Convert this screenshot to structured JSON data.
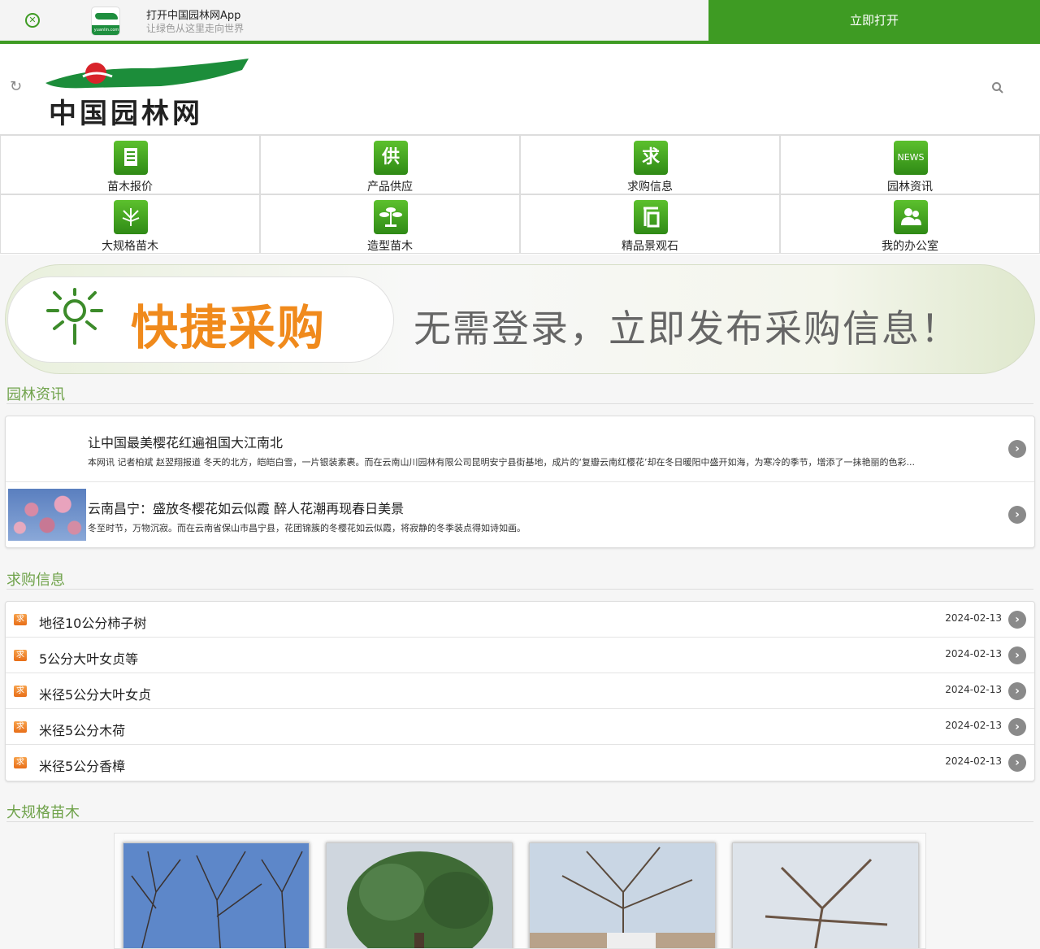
{
  "appbar": {
    "title": "打开中国园林网App",
    "subtitle": "让绿色从这里走向世界",
    "open_label": "立即打开",
    "logo_text": "yuanlin.com"
  },
  "header": {
    "logo_text": "中国园林网"
  },
  "nav": {
    "items": [
      {
        "label": "苗木报价",
        "icon": "document-icon"
      },
      {
        "label": "产品供应",
        "icon": "supply-icon"
      },
      {
        "label": "求购信息",
        "icon": "purchase-icon"
      },
      {
        "label": "园林资讯",
        "icon": "news-icon"
      },
      {
        "label": "大规格苗木",
        "icon": "tree-icon"
      },
      {
        "label": "造型苗木",
        "icon": "bonsai-icon"
      },
      {
        "label": "精品景观石",
        "icon": "stone-icon"
      },
      {
        "label": "我的办公室",
        "icon": "users-icon"
      }
    ],
    "glyphs": {
      "supply": "供",
      "purchase": "求",
      "news": "NEWS"
    }
  },
  "banner": {
    "quick": "快捷采购",
    "slogan": "无需登录，立即发布采购信息！"
  },
  "news_section": {
    "title": "园林资讯",
    "items": [
      {
        "title": "让中国最美樱花红遍祖国大江南北",
        "desc": "本网讯 记者柏斌 赵翌翔报道 冬天的北方，皑皑白雪，一片银装素裹。而在云南山川园林有限公司昆明安宁县街基地，成片的‘复瓣云南红樱花’却在冬日暖阳中盛开如海，为寒冷的季节，增添了一抹艳丽的色彩..."
      },
      {
        "title": "云南昌宁：盛放冬樱花如云似霞 醉人花潮再现春日美景",
        "desc": "冬至时节，万物沉寂。而在云南省保山市昌宁县，花团锦簇的冬樱花如云似霞，将寂静的冬季装点得如诗如画。"
      }
    ]
  },
  "buy_section": {
    "title": "求购信息",
    "tag": "求",
    "items": [
      {
        "name": "地径10公分柿子树",
        "date": "2024-02-13"
      },
      {
        "name": "5公分大叶女贞等",
        "date": "2024-02-13"
      },
      {
        "name": "米径5公分大叶女贞",
        "date": "2024-02-13"
      },
      {
        "name": "米径5公分木荷",
        "date": "2024-02-13"
      },
      {
        "name": "米径5公分香樟",
        "date": "2024-02-13"
      }
    ]
  },
  "large_section": {
    "title": "大规格苗木"
  },
  "colors": {
    "brand_green": "#3e9b23",
    "section_title": "#6fa24a",
    "quick_orange": "#f08a1c"
  }
}
